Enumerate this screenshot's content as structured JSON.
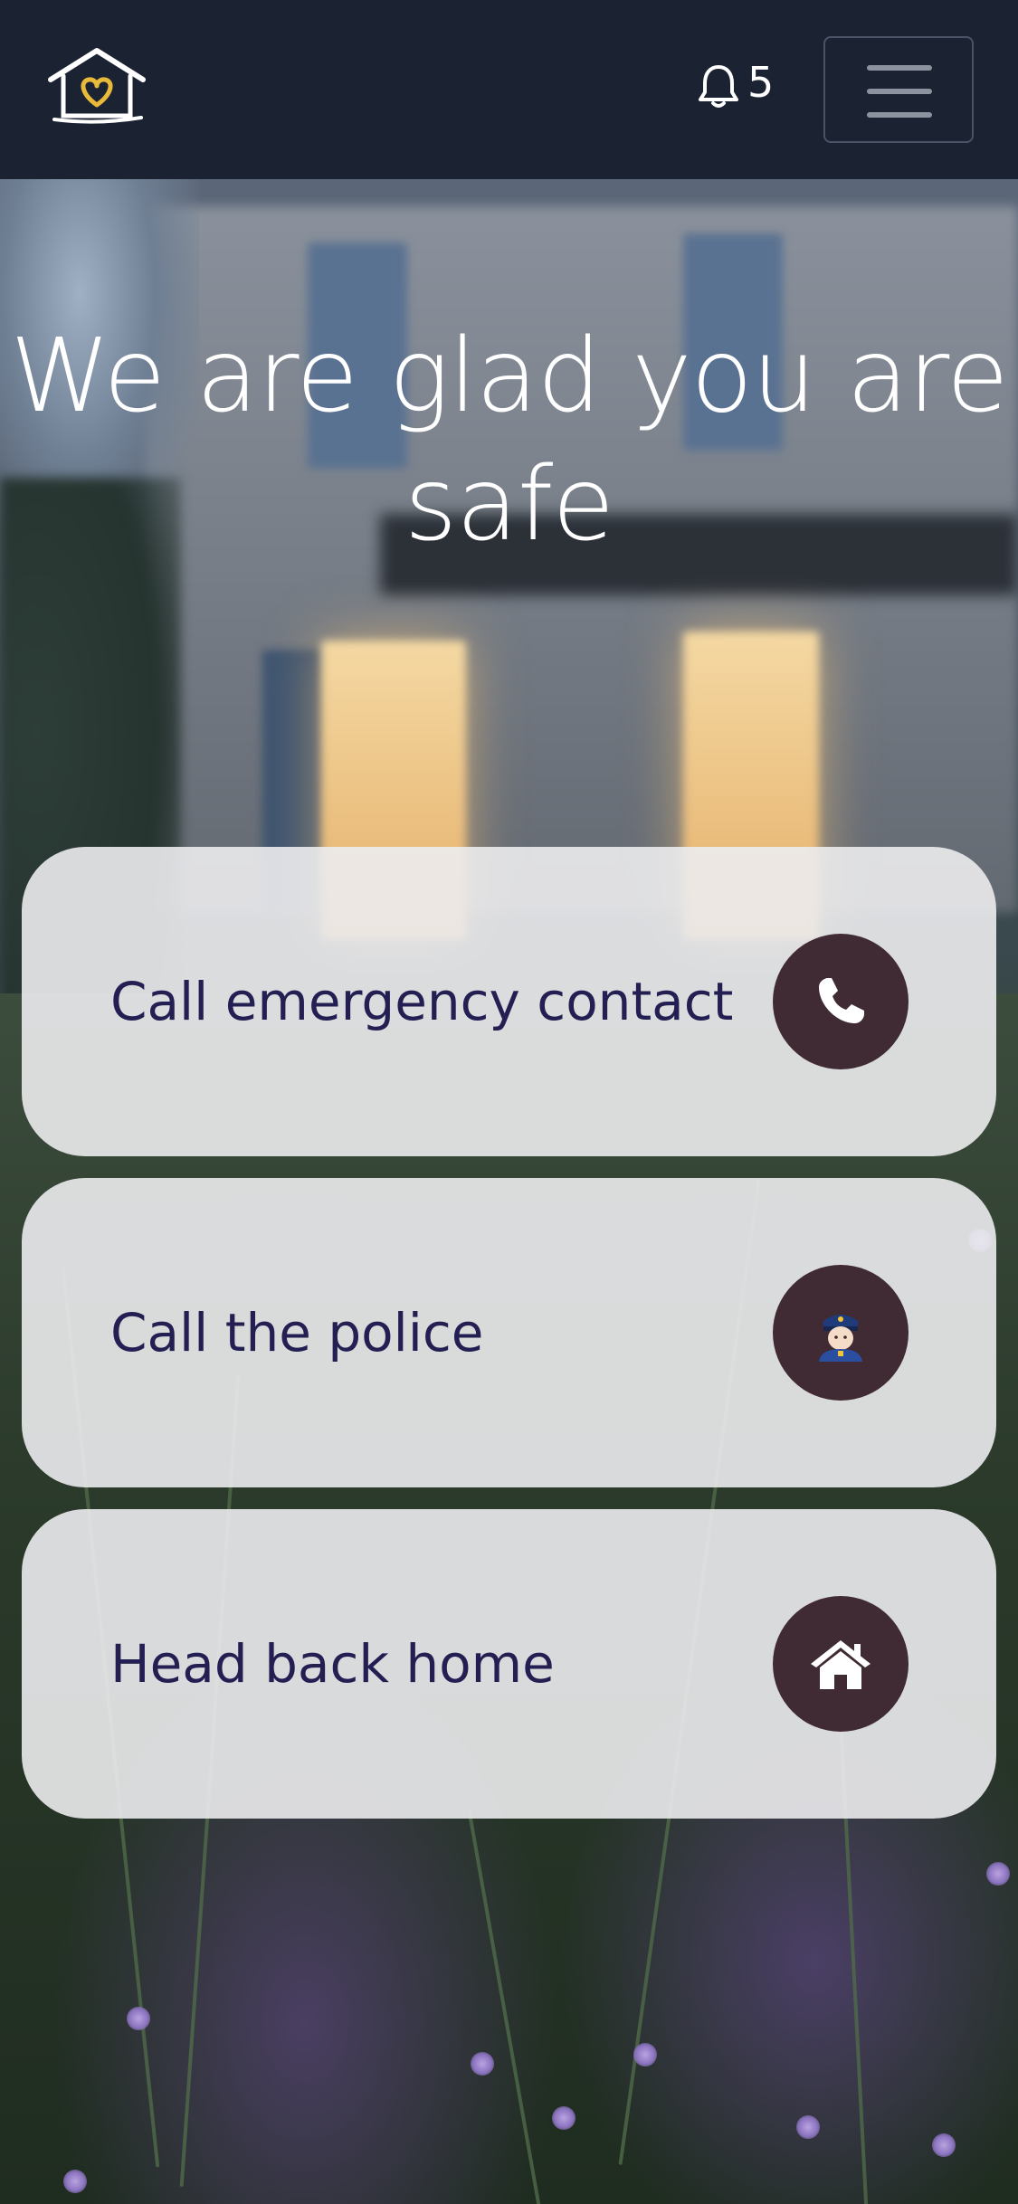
{
  "navbar": {
    "logo_icon": "house-heart-logo",
    "notifications": {
      "icon": "bell-icon",
      "count": "5"
    },
    "menu_icon": "hamburger-icon"
  },
  "hero": {
    "title": "We are glad you are safe"
  },
  "actions": [
    {
      "label": "Call emergency contact",
      "icon": "phone-icon"
    },
    {
      "label": "Call the police",
      "icon": "police-officer-icon"
    },
    {
      "label": "Head back home",
      "icon": "home-icon"
    }
  ],
  "colors": {
    "navbar_bg": "#1b2333",
    "card_bg": "#ececee",
    "card_text": "#231f52",
    "icon_circle": "#402a33",
    "logo_heart": "#e8b93a"
  }
}
